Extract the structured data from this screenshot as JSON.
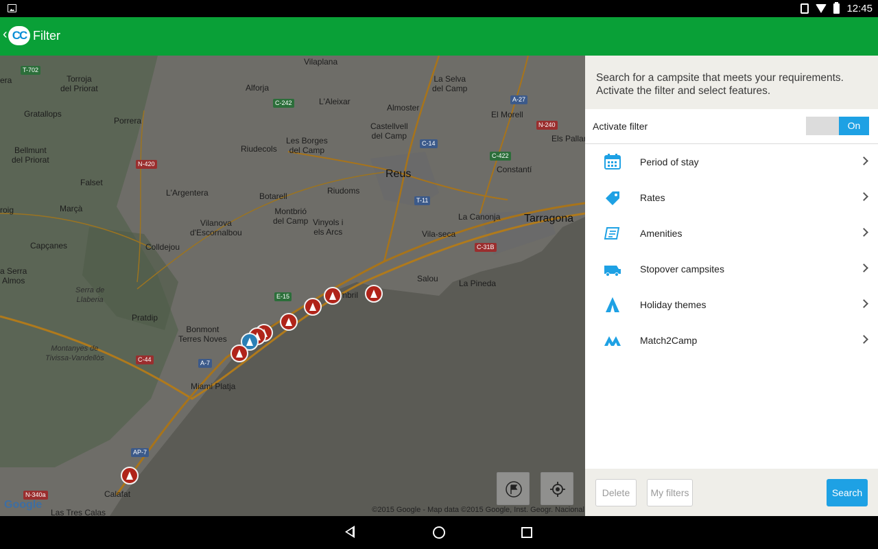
{
  "status_bar": {
    "time": "12:45"
  },
  "app_bar": {
    "title": "Filter",
    "logo_text": "CC"
  },
  "map": {
    "places": [
      {
        "label": "Vilaplana"
      },
      {
        "label": "Torroja\ndel Priorat"
      },
      {
        "label": "Alforja"
      },
      {
        "label": "La Selva\ndel Camp"
      },
      {
        "label": "Gratallops"
      },
      {
        "label": "L'Aleixar"
      },
      {
        "label": "Almoster"
      },
      {
        "label": "El Morell"
      },
      {
        "label": "Porrera"
      },
      {
        "label": "Castellvell\ndel Camp"
      },
      {
        "label": "Les Borges\ndel Camp"
      },
      {
        "label": "Riudecols"
      },
      {
        "label": "Bellmunt\ndel Priorat"
      },
      {
        "label": "Constantí"
      },
      {
        "label": "Els Pallar"
      },
      {
        "label": "Reus"
      },
      {
        "label": "Falset"
      },
      {
        "label": "L'Argentera"
      },
      {
        "label": "Botarell"
      },
      {
        "label": "Riudoms"
      },
      {
        "label": "roig"
      },
      {
        "label": "Marçà"
      },
      {
        "label": "Montbrió\ndel Camp"
      },
      {
        "label": "Vinyols i\nels Arcs"
      },
      {
        "label": "La Canonja"
      },
      {
        "label": "Tarragona"
      },
      {
        "label": "Vilanova\nd'Escornalbou"
      },
      {
        "label": "Vila-seca"
      },
      {
        "label": "Capçanes"
      },
      {
        "label": "Colldejou"
      },
      {
        "label": "a Serra\nAlmos"
      },
      {
        "label": "Salou"
      },
      {
        "label": "La Pineda"
      },
      {
        "label": "Serra de\nLlaberia"
      },
      {
        "label": "mbril"
      },
      {
        "label": "Pratdip"
      },
      {
        "label": "Bonmont\nTerres Noves"
      },
      {
        "label": "Montanyes de\nTivissa-Vandellòs"
      },
      {
        "label": "Miami Platja"
      },
      {
        "label": "Calafat"
      },
      {
        "label": "era"
      },
      {
        "label": "Las Tres Calas"
      }
    ],
    "roads": [
      {
        "label": "T-702"
      },
      {
        "label": "C-242"
      },
      {
        "label": "A-27"
      },
      {
        "label": "N-240"
      },
      {
        "label": "C-14"
      },
      {
        "label": "N-420"
      },
      {
        "label": "C-422"
      },
      {
        "label": "T-11"
      },
      {
        "label": "C-31B"
      },
      {
        "label": "E-15"
      },
      {
        "label": "A-7"
      },
      {
        "label": "C-44"
      },
      {
        "label": "AP-7"
      },
      {
        "label": "N-340a"
      }
    ],
    "google_label": "Google",
    "copyright": "©2015 Google - Map data ©2015 Google, Inst. Geogr. Nacional",
    "buttons": {
      "flag": "flag-icon",
      "locate": "gps-icon"
    }
  },
  "panel": {
    "intro": "Search for a campsite that meets your requirements. Activate the filter and select features.",
    "activate_label": "Activate filter",
    "toggle_on": "On",
    "menu": [
      {
        "label": "Period of stay",
        "icon": "calendar-icon"
      },
      {
        "label": "Rates",
        "icon": "price-tag-icon"
      },
      {
        "label": "Amenities",
        "icon": "amenities-icon"
      },
      {
        "label": "Stopover campsites",
        "icon": "camper-icon"
      },
      {
        "label": "Holiday themes",
        "icon": "tent-icon"
      },
      {
        "label": "Match2Camp",
        "icon": "match2camp-icon"
      }
    ],
    "footer": {
      "delete": "Delete",
      "my_filters": "My filters",
      "search": "Search"
    }
  },
  "colors": {
    "appbar": "#09a037",
    "accent": "#1ea1e4",
    "pin": "#b0241a"
  }
}
